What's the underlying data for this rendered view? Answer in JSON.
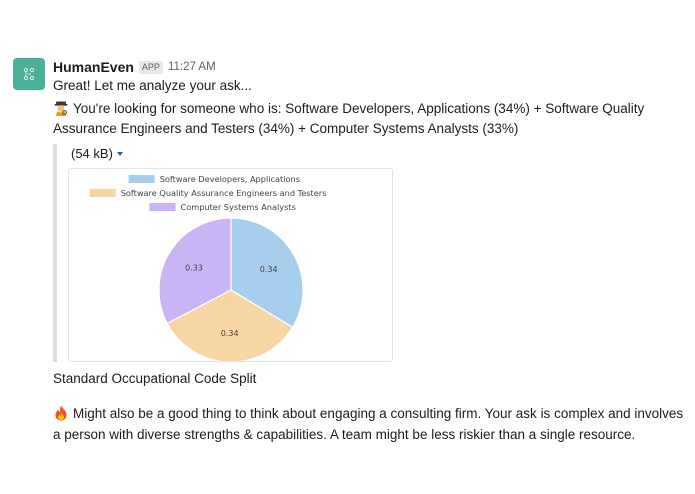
{
  "message": {
    "sender": "HumanEven",
    "app_badge": "APP",
    "time": "11:27 AM",
    "line1": "Great! Let me analyze your ask...",
    "line2": "You're looking for someone who is: Software Developers, Applications (34%) + Software Quality Assurance Engineers and Testers (34%) + Computer Systems Analysts (33%)",
    "line2_emoji": "detective-emoji",
    "file_size": "(54 kB)",
    "caption": "Standard Occupational Code Split",
    "paragraph": "Might also be a good thing to think about engaging a consulting firm. Your ask is complex and involves a person with diverse strengths & capabilities. A team might be less riskier than a single resource.",
    "paragraph_emoji": "fire-emoji"
  },
  "colors": {
    "avatar": "#4bb09a",
    "slice1": "#a6cfee",
    "slice2": "#f8d5a5",
    "slice3": "#c9b4f5"
  },
  "chart_data": {
    "type": "pie",
    "labels": [
      "Software Developers, Applications",
      "Software Quality Assurance Engineers and Testers",
      "Computer Systems Analysts"
    ],
    "values": [
      0.34,
      0.34,
      0.33
    ],
    "data_labels": [
      "0.34",
      "0.34",
      "0.33"
    ],
    "legend": "top",
    "colors": [
      "#a6cfee",
      "#f8d5a5",
      "#c9b4f5"
    ]
  }
}
